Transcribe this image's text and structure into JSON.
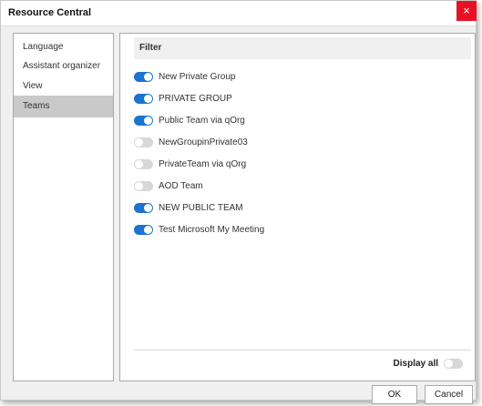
{
  "window": {
    "title": "Resource Central",
    "close_glyph": "×"
  },
  "nav": {
    "items": [
      {
        "label": "Language"
      },
      {
        "label": "Assistant organizer"
      },
      {
        "label": "View"
      },
      {
        "label": "Teams",
        "selected": true
      }
    ]
  },
  "filter": {
    "header": "Filter",
    "groups": [
      {
        "label": "New Private Group",
        "enabled": true
      },
      {
        "label": "PRIVATE GROUP",
        "enabled": true
      },
      {
        "label": "Public Team via qOrg",
        "enabled": true
      },
      {
        "label": "NewGroupinPrivate03",
        "enabled": false
      },
      {
        "label": "PrivateTeam via qOrg",
        "enabled": false
      },
      {
        "label": "AOD Team",
        "enabled": false
      },
      {
        "label": "NEW PUBLIC TEAM",
        "enabled": true
      },
      {
        "label": "Test Microsoft My Meeting",
        "enabled": true
      }
    ],
    "display_all": {
      "label": "Display all",
      "enabled": false
    }
  },
  "buttons": {
    "ok": "OK",
    "cancel": "Cancel"
  },
  "colors": {
    "accent": "#1c73d0",
    "toggle_off": "#d8d8d8",
    "close": "#e81123",
    "selected_nav": "#c9c9c9"
  }
}
